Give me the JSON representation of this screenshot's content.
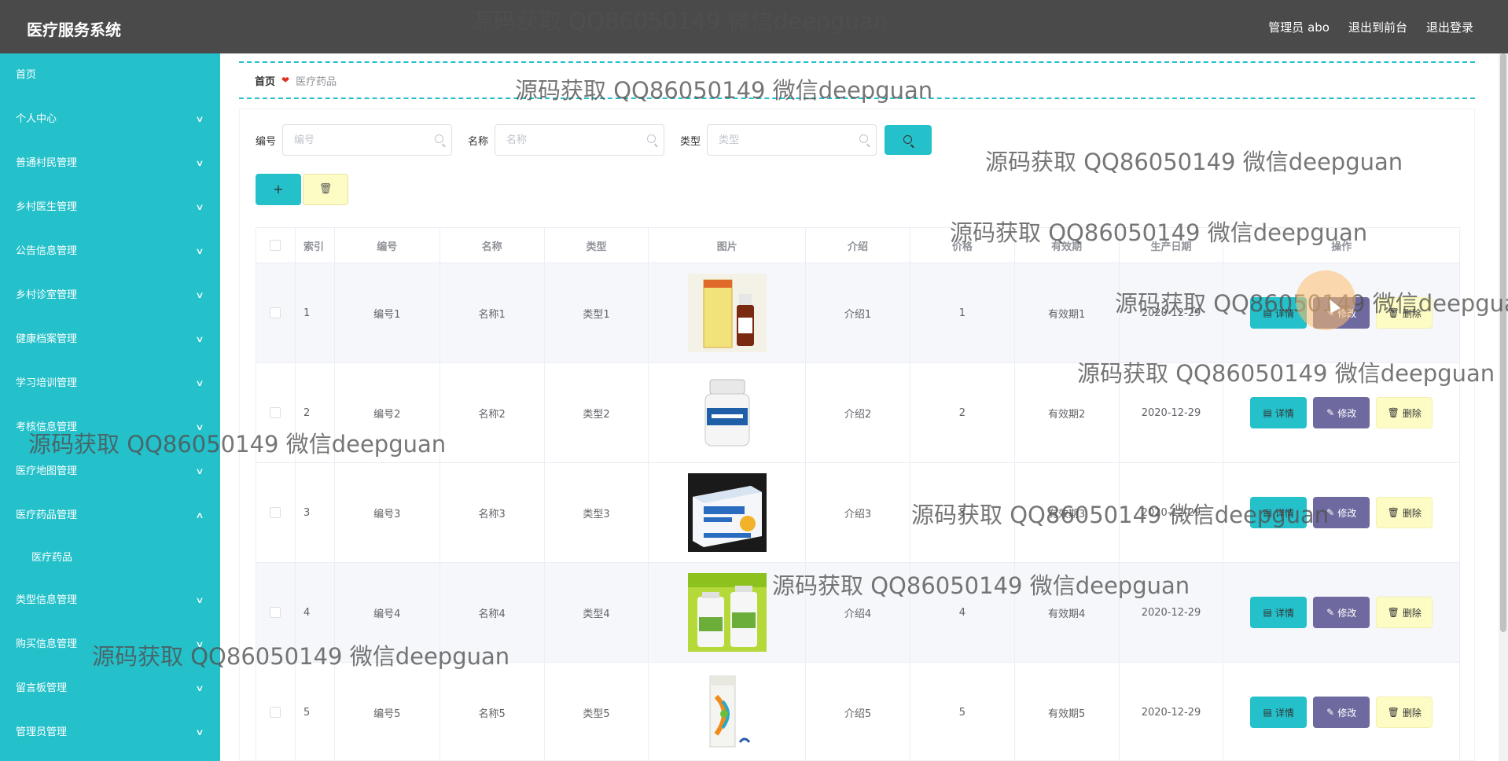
{
  "app": {
    "title": "医疗服务系统"
  },
  "top_actions": {
    "user": "管理员 abo",
    "front": "退出到前台",
    "logout": "退出登录"
  },
  "sidebar": {
    "items": [
      {
        "label": "首页",
        "chevron": ""
      },
      {
        "label": "个人中心",
        "chevron": "∨"
      },
      {
        "label": "普通村民管理",
        "chevron": "∨"
      },
      {
        "label": "乡村医生管理",
        "chevron": "∨"
      },
      {
        "label": "公告信息管理",
        "chevron": "∨"
      },
      {
        "label": "乡村诊室管理",
        "chevron": "∨"
      },
      {
        "label": "健康档案管理",
        "chevron": "∨"
      },
      {
        "label": "学习培训管理",
        "chevron": "∨"
      },
      {
        "label": "考核信息管理",
        "chevron": "∨"
      },
      {
        "label": "医疗地图管理",
        "chevron": "∨"
      },
      {
        "label": "医疗药品管理",
        "chevron": "∧"
      },
      {
        "label": "医疗药品",
        "sub": true
      },
      {
        "label": "类型信息管理",
        "chevron": "∨"
      },
      {
        "label": "购买信息管理",
        "chevron": "∨"
      },
      {
        "label": "留言板管理",
        "chevron": "∨"
      },
      {
        "label": "管理员管理",
        "chevron": "∨"
      }
    ]
  },
  "breadcrumb": {
    "home": "首页",
    "separator": "❤",
    "current": "医疗药品"
  },
  "search": {
    "fields": [
      {
        "label": "编号",
        "placeholder": "编号"
      },
      {
        "label": "名称",
        "placeholder": "名称"
      },
      {
        "label": "类型",
        "placeholder": "类型"
      }
    ]
  },
  "toolbar": {
    "add_label": "+",
    "delete_label": "🗑"
  },
  "table": {
    "headers": [
      "索引",
      "编号",
      "名称",
      "类型",
      "图片",
      "介绍",
      "价格",
      "有效期",
      "生产日期",
      "操作"
    ],
    "rows": [
      {
        "index": "1",
        "no": "编号1",
        "name": "名称1",
        "type": "类型1",
        "desc": "介绍1",
        "price": "1",
        "expiry": "有效期1",
        "date": "2020-12-29"
      },
      {
        "index": "2",
        "no": "编号2",
        "name": "名称2",
        "type": "类型2",
        "desc": "介绍2",
        "price": "2",
        "expiry": "有效期2",
        "date": "2020-12-29"
      },
      {
        "index": "3",
        "no": "编号3",
        "name": "名称3",
        "type": "类型3",
        "desc": "介绍3",
        "price": "3",
        "expiry": "有效期3",
        "date": "2020-12-29"
      },
      {
        "index": "4",
        "no": "编号4",
        "name": "名称4",
        "type": "类型4",
        "desc": "介绍4",
        "price": "4",
        "expiry": "有效期4",
        "date": "2020-12-29"
      },
      {
        "index": "5",
        "no": "编号5",
        "name": "名称5",
        "type": "类型5",
        "desc": "介绍5",
        "price": "5",
        "expiry": "有效期5",
        "date": "2020-12-29"
      }
    ],
    "ops": {
      "detail": "详情",
      "edit": "修改",
      "delete": "删除"
    }
  },
  "watermark": "源码获取 QQ86050149 微信deepguan",
  "colors": {
    "accent": "#24c1cb",
    "topbar": "#4a4a4a",
    "edit": "#6e6a9f",
    "delete": "#fdfcc4"
  }
}
